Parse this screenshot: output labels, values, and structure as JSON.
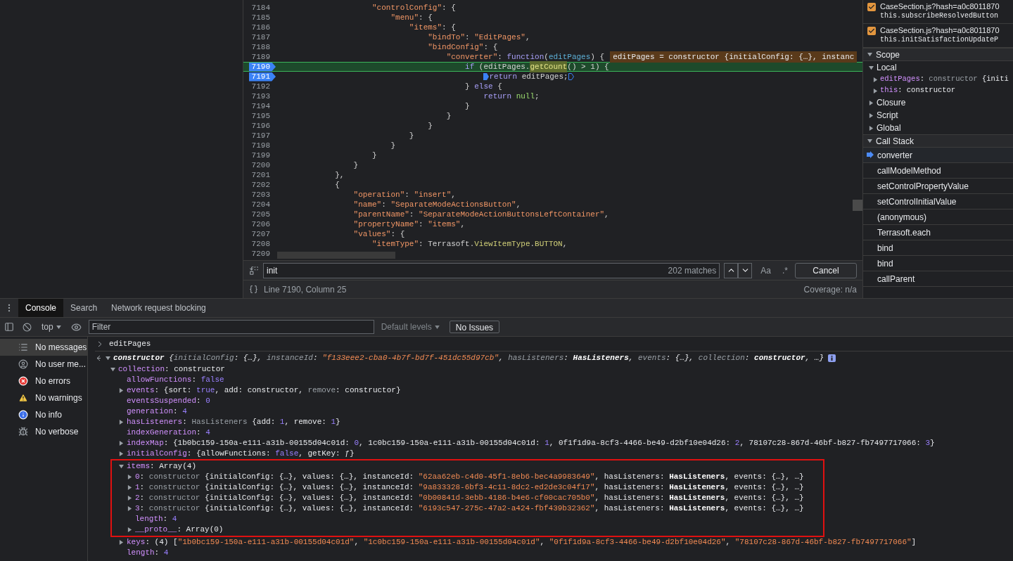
{
  "editor": {
    "lines": [
      {
        "number": "7184",
        "breakpoint": false,
        "current": false,
        "tokens": [
          {
            "kind": "k",
            "text": "                    \"controlConfig\""
          },
          {
            "kind": "t",
            "text": ": {"
          }
        ]
      },
      {
        "number": "7185",
        "breakpoint": false,
        "current": false,
        "tokens": [
          {
            "kind": "k",
            "text": "                        \"menu\""
          },
          {
            "kind": "t",
            "text": ": {"
          }
        ]
      },
      {
        "number": "7186",
        "breakpoint": false,
        "current": false,
        "tokens": [
          {
            "kind": "k",
            "text": "                            \"items\""
          },
          {
            "kind": "t",
            "text": ": {"
          }
        ]
      },
      {
        "number": "7187",
        "breakpoint": false,
        "current": false,
        "tokens": [
          {
            "kind": "k",
            "text": "                                \"bindTo\""
          },
          {
            "kind": "t",
            "text": ": "
          },
          {
            "kind": "s",
            "text": "\"EditPages\""
          },
          {
            "kind": "t",
            "text": ","
          }
        ]
      },
      {
        "number": "7188",
        "breakpoint": false,
        "current": false,
        "tokens": [
          {
            "kind": "k",
            "text": "                                \"bindConfig\""
          },
          {
            "kind": "t",
            "text": ": {"
          }
        ]
      },
      {
        "number": "7189",
        "breakpoint": false,
        "current": false,
        "tokens": [
          {
            "kind": "k",
            "text": "                                    \"converter\""
          },
          {
            "kind": "t",
            "text": ": "
          },
          {
            "kind": "w",
            "text": "function"
          },
          {
            "kind": "t",
            "text": "("
          },
          {
            "kind": "p",
            "text": "editPages"
          },
          {
            "kind": "t",
            "text": ") {"
          }
        ],
        "inline_value": "editPages = constructor {initialConfig: {…}, instanc"
      },
      {
        "number": "7190",
        "breakpoint": true,
        "current": true,
        "tokens": [
          {
            "kind": "w",
            "text": "                                        if"
          },
          {
            "kind": "t",
            "text": " (editPages."
          },
          {
            "kind": "m",
            "text": "getCount"
          },
          {
            "kind": "t",
            "text": "() > 1) {"
          }
        ]
      },
      {
        "number": "7191",
        "breakpoint": true,
        "current": false,
        "inline_markers": true,
        "tokens": [
          {
            "kind": "w",
            "text": "                                            return"
          },
          {
            "kind": "t",
            "text": " editPages;"
          }
        ]
      },
      {
        "number": "7192",
        "breakpoint": false,
        "current": false,
        "tokens": [
          {
            "kind": "t",
            "text": "                                        } "
          },
          {
            "kind": "w",
            "text": "else"
          },
          {
            "kind": "t",
            "text": " {"
          }
        ]
      },
      {
        "number": "7193",
        "breakpoint": false,
        "current": false,
        "tokens": [
          {
            "kind": "w",
            "text": "                                            return "
          },
          {
            "kind": "l",
            "text": "null"
          },
          {
            "kind": "t",
            "text": ";"
          }
        ]
      },
      {
        "number": "7194",
        "breakpoint": false,
        "current": false,
        "tokens": [
          {
            "kind": "t",
            "text": "                                        }"
          }
        ]
      },
      {
        "number": "7195",
        "breakpoint": false,
        "current": false,
        "tokens": [
          {
            "kind": "t",
            "text": "                                    }"
          }
        ]
      },
      {
        "number": "7196",
        "breakpoint": false,
        "current": false,
        "tokens": [
          {
            "kind": "t",
            "text": "                                }"
          }
        ]
      },
      {
        "number": "7197",
        "breakpoint": false,
        "current": false,
        "tokens": [
          {
            "kind": "t",
            "text": "                            }"
          }
        ]
      },
      {
        "number": "7198",
        "breakpoint": false,
        "current": false,
        "tokens": [
          {
            "kind": "t",
            "text": "                        }"
          }
        ]
      },
      {
        "number": "7199",
        "breakpoint": false,
        "current": false,
        "tokens": [
          {
            "kind": "t",
            "text": "                    }"
          }
        ]
      },
      {
        "number": "7200",
        "breakpoint": false,
        "current": false,
        "tokens": [
          {
            "kind": "t",
            "text": "                }"
          }
        ]
      },
      {
        "number": "7201",
        "breakpoint": false,
        "current": false,
        "tokens": [
          {
            "kind": "t",
            "text": "            },"
          }
        ]
      },
      {
        "number": "7202",
        "breakpoint": false,
        "current": false,
        "tokens": [
          {
            "kind": "t",
            "text": "            {"
          }
        ]
      },
      {
        "number": "7203",
        "breakpoint": false,
        "current": false,
        "tokens": [
          {
            "kind": "k",
            "text": "                \"operation\""
          },
          {
            "kind": "t",
            "text": ": "
          },
          {
            "kind": "s",
            "text": "\"insert\""
          },
          {
            "kind": "t",
            "text": ","
          }
        ]
      },
      {
        "number": "7204",
        "breakpoint": false,
        "current": false,
        "tokens": [
          {
            "kind": "k",
            "text": "                \"name\""
          },
          {
            "kind": "t",
            "text": ": "
          },
          {
            "kind": "s",
            "text": "\"SeparateModeActionsButton\""
          },
          {
            "kind": "t",
            "text": ","
          }
        ]
      },
      {
        "number": "7205",
        "breakpoint": false,
        "current": false,
        "tokens": [
          {
            "kind": "k",
            "text": "                \"parentName\""
          },
          {
            "kind": "t",
            "text": ": "
          },
          {
            "kind": "s",
            "text": "\"SeparateModeActionButtonsLeftContainer\""
          },
          {
            "kind": "t",
            "text": ","
          }
        ]
      },
      {
        "number": "7206",
        "breakpoint": false,
        "current": false,
        "tokens": [
          {
            "kind": "k",
            "text": "                \"propertyName\""
          },
          {
            "kind": "t",
            "text": ": "
          },
          {
            "kind": "s",
            "text": "\"items\""
          },
          {
            "kind": "t",
            "text": ","
          }
        ]
      },
      {
        "number": "7207",
        "breakpoint": false,
        "current": false,
        "tokens": [
          {
            "kind": "k",
            "text": "                \"values\""
          },
          {
            "kind": "t",
            "text": ": {"
          }
        ]
      },
      {
        "number": "7208",
        "breakpoint": false,
        "current": false,
        "tokens": [
          {
            "kind": "k",
            "text": "                    \"itemType\""
          },
          {
            "kind": "t",
            "text": ": Terrasoft."
          },
          {
            "kind": "y",
            "text": "ViewItemType"
          },
          {
            "kind": "t",
            "text": "."
          },
          {
            "kind": "y",
            "text": "BUTTON"
          },
          {
            "kind": "t",
            "text": ","
          }
        ]
      },
      {
        "number": "7209",
        "breakpoint": false,
        "current": false
      }
    ],
    "search": {
      "value": "init",
      "matches": "202 matches",
      "case_button": "Aa",
      "regex_button": ".*",
      "cancel": "Cancel"
    },
    "status": {
      "position": "Line 7190, Column 25",
      "coverage": "Coverage: n/a"
    }
  },
  "debugger": {
    "breakpoints": [
      {
        "file": "CaseSection.js?hash=a0c8011870",
        "code": "this.subscribeResolvedButton",
        "checked": true
      },
      {
        "file": "CaseSection.js?hash=a0c8011870",
        "code": "this.initSatisfactionUpdateP",
        "checked": true
      }
    ],
    "scope": {
      "title": "Scope",
      "expanded": true,
      "sections": [
        {
          "name": "Local",
          "expanded": true,
          "vars": [
            {
              "expanded": false,
              "tokens": [
                {
                  "kind": "n",
                  "text": "editPages"
                },
                {
                  "kind": "t",
                  "text": ": "
                },
                {
                  "kind": "g",
                  "text": "constructor "
                },
                {
                  "kind": "t",
                  "text": "{initi"
                }
              ]
            },
            {
              "expanded": false,
              "tokens": [
                {
                  "kind": "n",
                  "text": "this"
                },
                {
                  "kind": "t",
                  "text": ": constructor"
                }
              ]
            }
          ]
        },
        {
          "name": "Closure",
          "expanded": false
        },
        {
          "name": "Script",
          "expanded": false
        },
        {
          "name": "Global",
          "expanded": false
        }
      ]
    },
    "call_stack": {
      "title": "Call Stack",
      "expanded": true,
      "frames": [
        {
          "name": "converter",
          "selected": true
        },
        {
          "name": "callModelMethod",
          "selected": false
        },
        {
          "name": "setControlPropertyValue",
          "selected": false
        },
        {
          "name": "setControlInitialValue",
          "selected": false
        },
        {
          "name": "(anonymous)",
          "selected": false
        },
        {
          "name": "Terrasoft.each",
          "selected": false
        },
        {
          "name": "bind",
          "selected": false
        },
        {
          "name": "bind",
          "selected": false
        },
        {
          "name": "callParent",
          "selected": false
        }
      ]
    }
  },
  "drawer": {
    "tabs": [
      {
        "label": "Console",
        "selected": true
      },
      {
        "label": "Search",
        "selected": false
      },
      {
        "label": "Network request blocking",
        "selected": false
      }
    ],
    "toolbar": {
      "context": "top",
      "filter_placeholder": "Filter",
      "levels": "Default levels",
      "issues": "No Issues"
    },
    "sidebar": [
      {
        "label": "No messages",
        "kind": "messages",
        "selected": true
      },
      {
        "label": "No user me...",
        "kind": "user",
        "selected": false
      },
      {
        "label": "No errors",
        "kind": "error",
        "selected": false
      },
      {
        "label": "No warnings",
        "kind": "warning",
        "selected": false
      },
      {
        "label": "No info",
        "kind": "info",
        "selected": false
      },
      {
        "label": "No verbose",
        "kind": "verbose",
        "selected": false
      }
    ],
    "input": "editPages",
    "result": {
      "expanded": true,
      "tokens": [
        {
          "kind": "b",
          "text": "constructor"
        },
        {
          "kind": "t",
          "text": " {"
        },
        {
          "kind": "dn",
          "text": "initialConfig"
        },
        {
          "kind": "t",
          "text": ": {…}, "
        },
        {
          "kind": "dn",
          "text": "instanceId"
        },
        {
          "kind": "t",
          "text": ": "
        },
        {
          "kind": "s",
          "text": "\"f133eee2-cba0-4b7f-bd7f-451dc55d97cb\""
        },
        {
          "kind": "t",
          "text": ", "
        },
        {
          "kind": "dn",
          "text": "hasListeners"
        },
        {
          "kind": "t",
          "text": ": "
        },
        {
          "kind": "b",
          "text": "HasListeners"
        },
        {
          "kind": "t",
          "text": ", "
        },
        {
          "kind": "dn",
          "text": "events"
        },
        {
          "kind": "t",
          "text": ": {…}, "
        },
        {
          "kind": "dn",
          "text": "collection"
        },
        {
          "kind": "t",
          "text": ": "
        },
        {
          "kind": "b",
          "text": "constructor"
        },
        {
          "kind": "t",
          "text": ", …}"
        }
      ],
      "children": [
        {
          "expanded": true,
          "tokens": [
            {
              "kind": "n",
              "text": "collection"
            },
            {
              "kind": "t",
              "text": ": constructor"
            }
          ],
          "children": [
            {
              "tokens": [
                {
                  "kind": "n",
                  "text": "allowFunctions"
                },
                {
                  "kind": "t",
                  "text": ": "
                },
                {
                  "kind": "v",
                  "text": "false"
                }
              ]
            },
            {
              "expanded": false,
              "tokens": [
                {
                  "kind": "n",
                  "text": "events"
                },
                {
                  "kind": "t",
                  "text": ": {sort: "
                },
                {
                  "kind": "v",
                  "text": "true"
                },
                {
                  "kind": "t",
                  "text": ", add: constructor, "
                },
                {
                  "kind": "g",
                  "text": "remove"
                },
                {
                  "kind": "t",
                  "text": ": constructor}"
                }
              ]
            },
            {
              "tokens": [
                {
                  "kind": "n",
                  "text": "eventsSuspended"
                },
                {
                  "kind": "t",
                  "text": ": "
                },
                {
                  "kind": "v",
                  "text": "0"
                }
              ]
            },
            {
              "tokens": [
                {
                  "kind": "n",
                  "text": "generation"
                },
                {
                  "kind": "t",
                  "text": ": "
                },
                {
                  "kind": "v",
                  "text": "4"
                }
              ]
            },
            {
              "expanded": false,
              "tokens": [
                {
                  "kind": "n",
                  "text": "hasListeners"
                },
                {
                  "kind": "t",
                  "text": ": "
                },
                {
                  "kind": "g",
                  "text": "HasListeners"
                },
                {
                  "kind": "t",
                  "text": " {add: "
                },
                {
                  "kind": "v",
                  "text": "1"
                },
                {
                  "kind": "t",
                  "text": ", remove: "
                },
                {
                  "kind": "v",
                  "text": "1"
                },
                {
                  "kind": "t",
                  "text": "}"
                }
              ]
            },
            {
              "tokens": [
                {
                  "kind": "n",
                  "text": "indexGeneration"
                },
                {
                  "kind": "t",
                  "text": ": "
                },
                {
                  "kind": "v",
                  "text": "4"
                }
              ]
            },
            {
              "expanded": false,
              "tokens": [
                {
                  "kind": "n",
                  "text": "indexMap"
                },
                {
                  "kind": "t",
                  "text": ": {1b0bc159-150a-e111-a31b-00155d04c01d: "
                },
                {
                  "kind": "v",
                  "text": "0"
                },
                {
                  "kind": "t",
                  "text": ", 1c0bc159-150a-e111-a31b-00155d04c01d: "
                },
                {
                  "kind": "v",
                  "text": "1"
                },
                {
                  "kind": "t",
                  "text": ", 0f1f1d9a-8cf3-4466-be49-d2bf10e04d26: "
                },
                {
                  "kind": "v",
                  "text": "2"
                },
                {
                  "kind": "t",
                  "text": ", 78107c28-867d-46bf-b827-fb7497717066: "
                },
                {
                  "kind": "v",
                  "text": "3"
                },
                {
                  "kind": "t",
                  "text": "}"
                }
              ]
            },
            {
              "expanded": false,
              "tokens": [
                {
                  "kind": "n",
                  "text": "initialConfig"
                },
                {
                  "kind": "t",
                  "text": ": {allowFunctions: "
                },
                {
                  "kind": "v",
                  "text": "false"
                },
                {
                  "kind": "t",
                  "text": ", getKey: ƒ}"
                }
              ]
            },
            {
              "expanded": true,
              "outlined": true,
              "tokens": [
                {
                  "kind": "n",
                  "text": "items"
                },
                {
                  "kind": "t",
                  "text": ": Array(4)"
                }
              ],
              "children": [
                {
                  "expanded": false,
                  "tokens": [
                    {
                      "kind": "n",
                      "text": "0"
                    },
                    {
                      "kind": "t",
                      "text": ": "
                    },
                    {
                      "kind": "g",
                      "text": "constructor"
                    },
                    {
                      "kind": "t",
                      "text": " {initialConfig: {…}, values: {…}, instanceId: "
                    },
                    {
                      "kind": "s",
                      "text": "\"62aa62eb-c4d0-45f1-8eb6-bec4a9983649\""
                    },
                    {
                      "kind": "t",
                      "text": ", hasListeners: "
                    },
                    {
                      "kind": "b",
                      "text": "HasListeners"
                    },
                    {
                      "kind": "t",
                      "text": ", events: {…}, …}"
                    }
                  ]
                },
                {
                  "expanded": false,
                  "tokens": [
                    {
                      "kind": "n",
                      "text": "1"
                    },
                    {
                      "kind": "t",
                      "text": ": "
                    },
                    {
                      "kind": "g",
                      "text": "constructor"
                    },
                    {
                      "kind": "t",
                      "text": " {initialConfig: {…}, values: {…}, instanceId: "
                    },
                    {
                      "kind": "s",
                      "text": "\"9a833328-6bf3-4c11-8dc2-ed2de3c04f17\""
                    },
                    {
                      "kind": "t",
                      "text": ", hasListeners: "
                    },
                    {
                      "kind": "b",
                      "text": "HasListeners"
                    },
                    {
                      "kind": "t",
                      "text": ", events: {…}, …}"
                    }
                  ]
                },
                {
                  "expanded": false,
                  "tokens": [
                    {
                      "kind": "n",
                      "text": "2"
                    },
                    {
                      "kind": "t",
                      "text": ": "
                    },
                    {
                      "kind": "g",
                      "text": "constructor"
                    },
                    {
                      "kind": "t",
                      "text": " {initialConfig: {…}, values: {…}, instanceId: "
                    },
                    {
                      "kind": "s",
                      "text": "\"0b00841d-3ebb-4186-b4e6-cf00cac705b0\""
                    },
                    {
                      "kind": "t",
                      "text": ", hasListeners: "
                    },
                    {
                      "kind": "b",
                      "text": "HasListeners"
                    },
                    {
                      "kind": "t",
                      "text": ", events: {…}, …}"
                    }
                  ]
                },
                {
                  "expanded": false,
                  "tokens": [
                    {
                      "kind": "n",
                      "text": "3"
                    },
                    {
                      "kind": "t",
                      "text": ": "
                    },
                    {
                      "kind": "g",
                      "text": "constructor"
                    },
                    {
                      "kind": "t",
                      "text": " {initialConfig: {…}, values: {…}, instanceId: "
                    },
                    {
                      "kind": "s",
                      "text": "\"6193c547-275c-47a2-a424-fbf439b32362\""
                    },
                    {
                      "kind": "t",
                      "text": ", hasListeners: "
                    },
                    {
                      "kind": "b",
                      "text": "HasListeners"
                    },
                    {
                      "kind": "t",
                      "text": ", events: {…}, …}"
                    }
                  ]
                },
                {
                  "tokens": [
                    {
                      "kind": "n",
                      "text": "length"
                    },
                    {
                      "kind": "t",
                      "text": ": "
                    },
                    {
                      "kind": "v",
                      "text": "4"
                    }
                  ]
                },
                {
                  "expanded": false,
                  "tokens": [
                    {
                      "kind": "n",
                      "text": "__proto__"
                    },
                    {
                      "kind": "t",
                      "text": ": Array(0)"
                    }
                  ]
                }
              ]
            },
            {
              "expanded": false,
              "tokens": [
                {
                  "kind": "n",
                  "text": "keys"
                },
                {
                  "kind": "t",
                  "text": ": (4) ["
                },
                {
                  "kind": "s",
                  "text": "\"1b0bc159-150a-e111-a31b-00155d04c01d\""
                },
                {
                  "kind": "t",
                  "text": ", "
                },
                {
                  "kind": "s",
                  "text": "\"1c0bc159-150a-e111-a31b-00155d04c01d\""
                },
                {
                  "kind": "t",
                  "text": ", "
                },
                {
                  "kind": "s",
                  "text": "\"0f1f1d9a-8cf3-4466-be49-d2bf10e04d26\""
                },
                {
                  "kind": "t",
                  "text": ", "
                },
                {
                  "kind": "s",
                  "text": "\"78107c28-867d-46bf-b827-fb7497717066\""
                },
                {
                  "kind": "t",
                  "text": "]"
                }
              ]
            },
            {
              "tokens": [
                {
                  "kind": "n",
                  "text": "length"
                },
                {
                  "kind": "t",
                  "text": ": "
                },
                {
                  "kind": "v",
                  "text": "4"
                }
              ]
            }
          ]
        }
      ]
    }
  }
}
